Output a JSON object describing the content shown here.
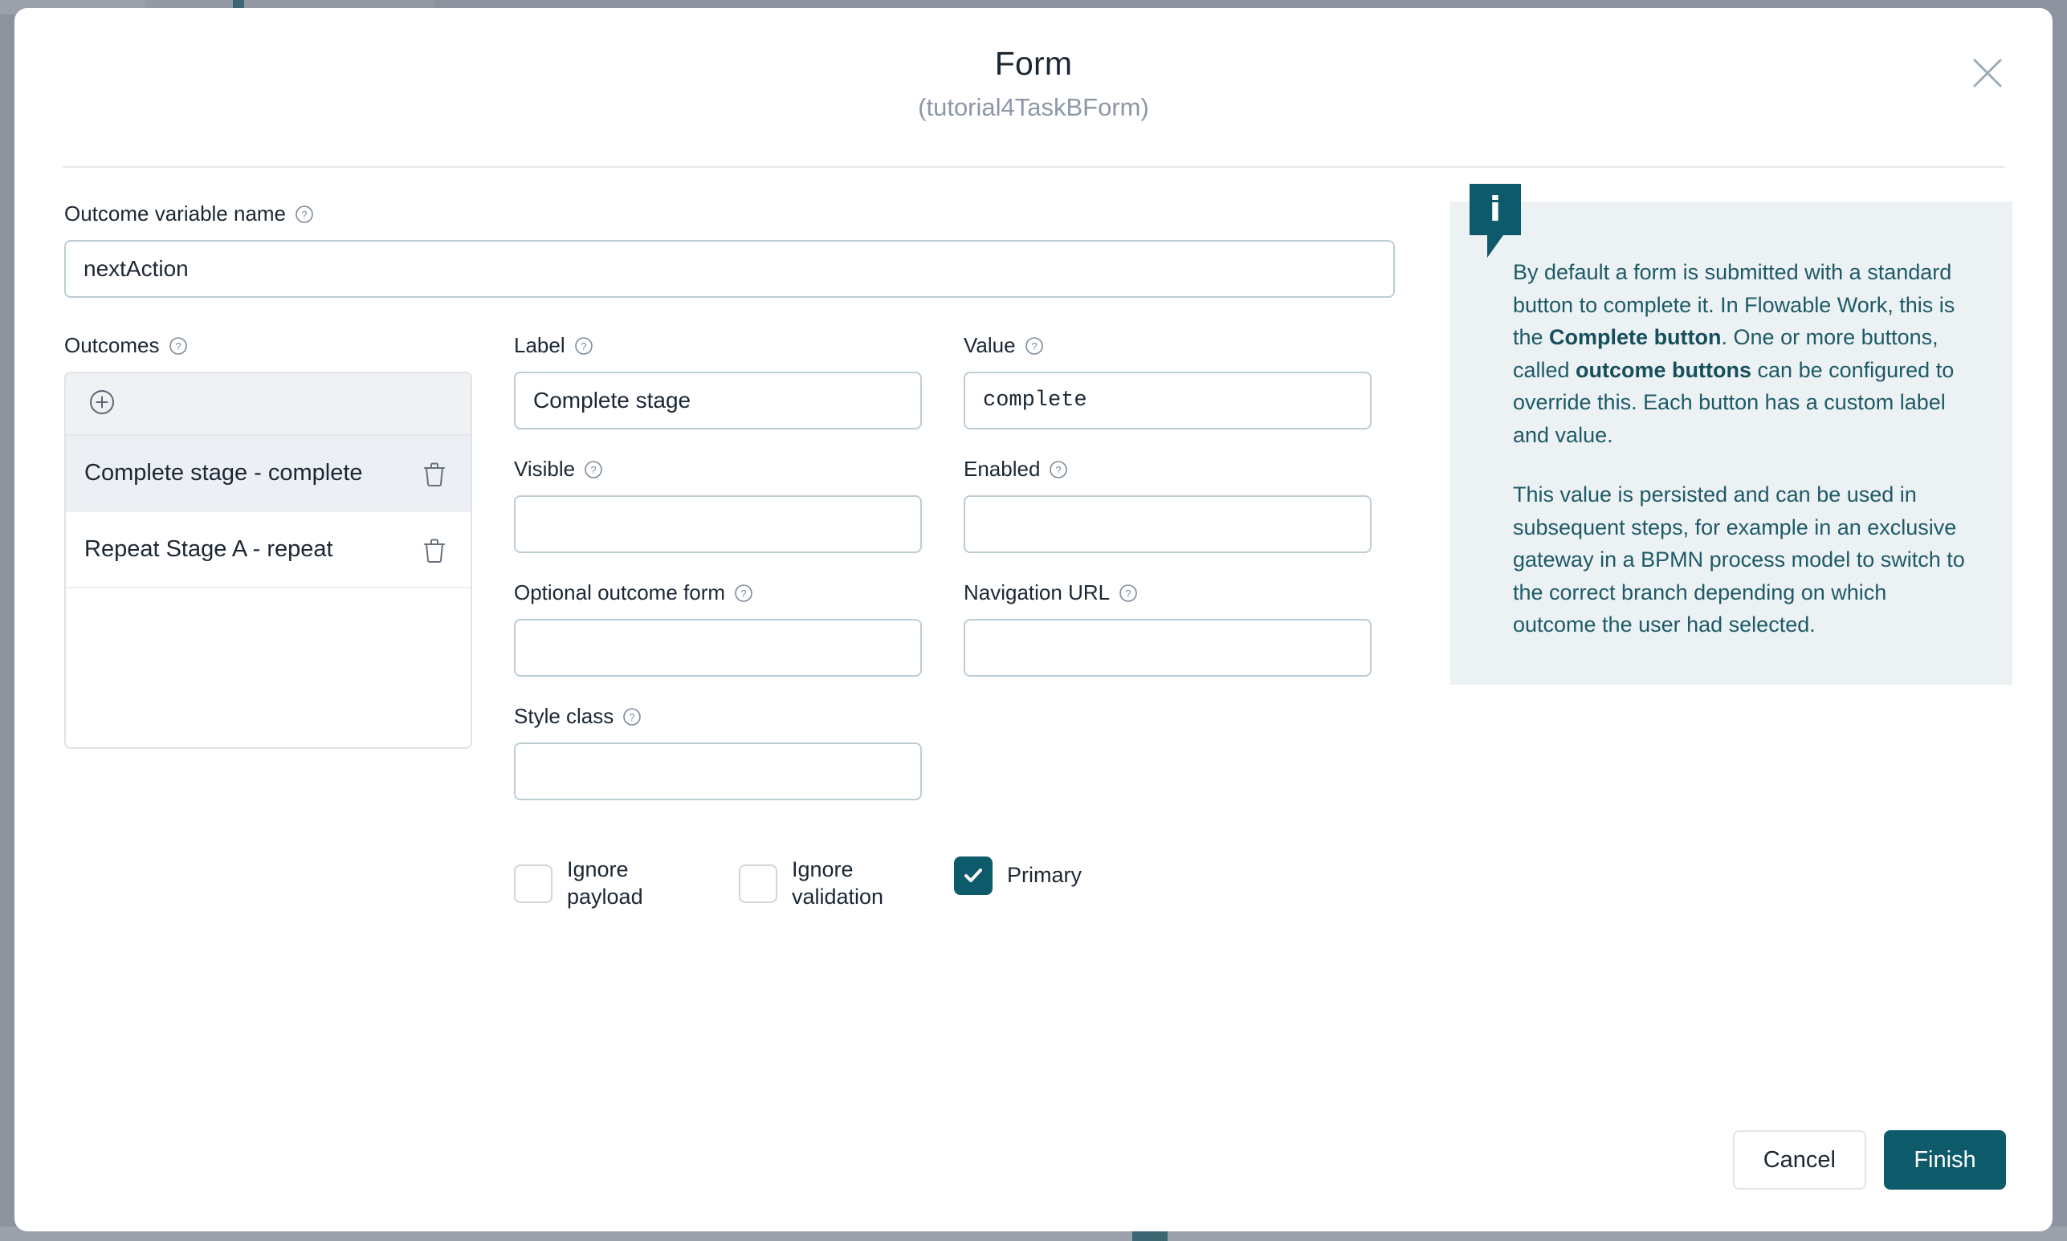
{
  "modal": {
    "title": "Form",
    "subtitle": "(tutorial4TaskBForm)",
    "close_icon": "close-icon"
  },
  "accent_color": "#0d5a6b",
  "panel_bg": "#ecf1f3",
  "outcome_variable": {
    "label": "Outcome variable name",
    "value": "nextAction",
    "placeholder": ""
  },
  "outcomes": {
    "label": "Outcomes",
    "add_icon": "plus-circle-icon",
    "items": [
      {
        "text": "Complete stage - complete",
        "selected": true,
        "delete_icon": "trash-icon"
      },
      {
        "text": "Repeat Stage A - repeat",
        "selected": false,
        "delete_icon": "trash-icon"
      }
    ]
  },
  "detail": {
    "label_field": {
      "label": "Label",
      "value": "Complete stage",
      "placeholder": ""
    },
    "value_field": {
      "label": "Value",
      "value": "complete",
      "placeholder": ""
    },
    "visible_field": {
      "label": "Visible",
      "value": "",
      "placeholder": ""
    },
    "enabled_field": {
      "label": "Enabled",
      "value": "",
      "placeholder": ""
    },
    "optional_outcome_form": {
      "label": "Optional outcome form",
      "value": "",
      "placeholder": ""
    },
    "navigation_url": {
      "label": "Navigation URL",
      "value": "",
      "placeholder": ""
    },
    "style_class": {
      "label": "Style class",
      "value": "",
      "placeholder": ""
    }
  },
  "checkboxes": [
    {
      "label": "Ignore payload",
      "checked": false
    },
    {
      "label": "Ignore validation",
      "checked": false
    },
    {
      "label": "Primary",
      "checked": true
    }
  ],
  "info": {
    "icon": "info-icon",
    "glyph": "i",
    "paragraph1_part1": "By default a form is submitted with a standard button to complete it. In Flowable Work, this is the ",
    "paragraph1_bold1": "Complete button",
    "paragraph1_part2": ". One or more buttons, called ",
    "paragraph1_bold2": "outcome buttons",
    "paragraph1_part3": " can be configured to override this. Each button has a custom label and value.",
    "paragraph2": "This value is persisted and can be used in subsequent steps, for example in an exclusive gateway in a BPMN process model to switch to the correct branch depending on which outcome the user had selected."
  },
  "footer": {
    "cancel_label": "Cancel",
    "finish_label": "Finish"
  }
}
